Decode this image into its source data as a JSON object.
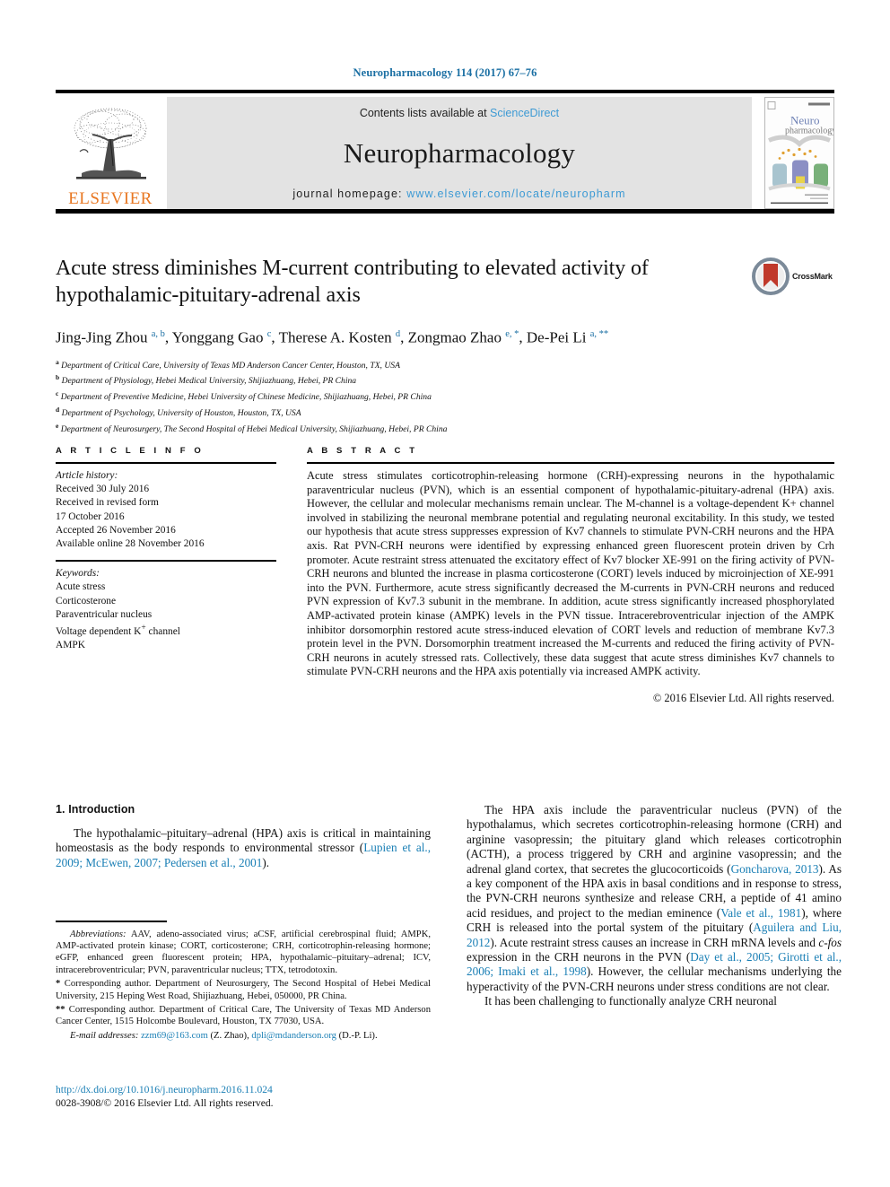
{
  "running_head": "Neuropharmacology 114 (2017) 67–76",
  "masthead": {
    "elsevier_wordmark": "ELSEVIER",
    "contents_prefix": "Contents lists available at ",
    "contents_link": "ScienceDirect",
    "journal_title": "Neuropharmacology",
    "homepage_prefix": "journal homepage: ",
    "homepage_url": "www.elsevier.com/locate/neuropharm",
    "cover_title_line1": "Neuro",
    "cover_title_line2": "pharmacology",
    "link_color": "#3d9ad4",
    "band_color": "#e3e3e3",
    "elsevier_orange": "#E87722"
  },
  "article": {
    "title": "Acute stress diminishes M-current contributing to elevated activity of hypothalamic-pituitary-adrenal axis",
    "crossmark_label": "CrossMark",
    "authors_html": "Jing-Jing Zhou <sup>a, b</sup>, Yonggang Gao <sup>c</sup>, Therese A. Kosten <sup>d</sup>, Zongmao Zhao <sup>e, *</sup>, De-Pei Li <sup>a, **</sup>",
    "affiliations": [
      {
        "marker": "a",
        "text": "Department of Critical Care, University of Texas MD Anderson Cancer Center, Houston, TX, USA"
      },
      {
        "marker": "b",
        "text": "Department of Physiology, Hebei Medical University, Shijiazhuang, Hebei, PR China"
      },
      {
        "marker": "c",
        "text": "Department of Preventive Medicine, Hebei University of Chinese Medicine, Shijiazhuang, Hebei, PR China"
      },
      {
        "marker": "d",
        "text": "Department of Psychology, University of Houston, Houston, TX, USA"
      },
      {
        "marker": "e",
        "text": "Department of Neurosurgery, The Second Hospital of Hebei Medical University, Shijiazhuang, Hebei, PR China"
      }
    ]
  },
  "article_info": {
    "heading": "A R T I C L E  I N F O",
    "history_label": "Article history:",
    "history": [
      "Received 30 July 2016",
      "Received in revised form",
      "17 October 2016",
      "Accepted 26 November 2016",
      "Available online 28 November 2016"
    ],
    "keywords_label": "Keywords:",
    "keywords_html": [
      "Acute stress",
      "Corticosterone",
      "Paraventricular nucleus",
      "Voltage dependent K<sup>+</sup> channel",
      "AMPK"
    ]
  },
  "abstract": {
    "heading": "A B S T R A C T",
    "text": "Acute stress stimulates corticotrophin-releasing hormone (CRH)-expressing neurons in the hypothalamic paraventricular nucleus (PVN), which is an essential component of hypothalamic-pituitary-adrenal (HPA) axis. However, the cellular and molecular mechanisms remain unclear. The M-channel is a voltage-dependent K+ channel involved in stabilizing the neuronal membrane potential and regulating neuronal excitability. In this study, we tested our hypothesis that acute stress suppresses expression of Kv7 channels to stimulate PVN-CRH neurons and the HPA axis. Rat PVN-CRH neurons were identified by expressing enhanced green fluorescent protein driven by Crh promoter. Acute restraint stress attenuated the excitatory effect of Kv7 blocker XE-991 on the firing activity of PVN-CRH neurons and blunted the increase in plasma corticosterone (CORT) levels induced by microinjection of XE-991 into the PVN. Furthermore, acute stress significantly decreased the M-currents in PVN-CRH neurons and reduced PVN expression of Kv7.3 subunit in the membrane. In addition, acute stress significantly increased phosphorylated AMP-activated protein kinase (AMPK) levels in the PVN tissue. Intracerebroventricular injection of the AMPK inhibitor dorsomorphin restored acute stress-induced elevation of CORT levels and reduction of membrane Kv7.3 protein level in the PVN. Dorsomorphin treatment increased the M-currents and reduced the firing activity of PVN-CRH neurons in acutely stressed rats. Collectively, these data suggest that acute stress diminishes Kv7 channels to stimulate PVN-CRH neurons and the HPA axis potentially via increased AMPK activity.",
    "copyright": "© 2016 Elsevier Ltd. All rights reserved."
  },
  "introduction": {
    "heading": "1.  Introduction",
    "para1_html": "The hypothalamic&#8211;pituitary&#8211;adrenal (HPA) axis is critical in maintaining homeostasis as the body responds to environmental stressor (<span class=\"ref\">Lupien et al., 2009; McEwen, 2007; Pedersen et al., 2001</span>).",
    "para2_html": "The HPA axis include the paraventricular nucleus (PVN) of the hypothalamus, which secretes corticotrophin-releasing hormone (CRH) and arginine vasopressin; the pituitary gland which releases corticotrophin (ACTH), a process triggered by CRH and arginine vasopressin; and the adrenal gland cortex, that secretes the glucocorticoids (<span class=\"ref\">Goncharova, 2013</span>). As a key component of the HPA axis in basal conditions and in response to stress, the PVN-CRH neurons synthesize and release CRH, a peptide of 41 amino acid residues, and project to the median eminence (<span class=\"ref\">Vale et al., 1981</span>), where CRH is released into the portal system of the pituitary (<span class=\"ref\">Aguilera and Liu, 2012</span>). Acute restraint stress causes an increase in CRH mRNA levels and <i>c-fos</i> expression in the CRH neurons in the PVN (<span class=\"ref\">Day et al., 2005; Girotti et al., 2006; Imaki et al., 1998</span>). However, the cellular mechanisms underlying the hyperactivity of the PVN-CRH neurons under stress conditions are not clear.",
    "para3_html": "It has been challenging to functionally analyze CRH neuronal"
  },
  "footnotes": {
    "abbreviations_html": "<i>Abbreviations:</i> AAV, adeno-associated virus; aCSF, artificial cerebrospinal fluid; AMPK, AMP-activated protein kinase; CORT, corticosterone; CRH, corticotrophin-releasing hormone; eGFP, enhanced green fluorescent protein; HPA, hypothalamic&#8211;pituitary&#8211;adrenal; ICV, intracerebroventricular; PVN, paraventricular nucleus; TTX, tetrodotoxin.",
    "corr1_html": "<span class=\"star\">*</span> Corresponding author. Department of Neurosurgery, The Second Hospital of Hebei Medical University, 215 Heping West Road, Shijiazhuang, Hebei, 050000, PR China.",
    "corr2_html": "<span class=\"star\">**</span> Corresponding author. Department of Critical Care, The University of Texas MD Anderson Cancer Center, 1515 Holcombe Boulevard, Houston, TX 77030, USA.",
    "email_html": "<i>E-mail addresses:</i> <span class=\"ref\">zzm69@163.com</span> (Z. Zhao), <span class=\"ref\">dpli@mdanderson.org</span> (D.-P. Li)."
  },
  "page_footer": {
    "doi": "http://dx.doi.org/10.1016/j.neuropharm.2016.11.024",
    "issn_line": "0028-3908/© 2016 Elsevier Ltd. All rights reserved."
  }
}
